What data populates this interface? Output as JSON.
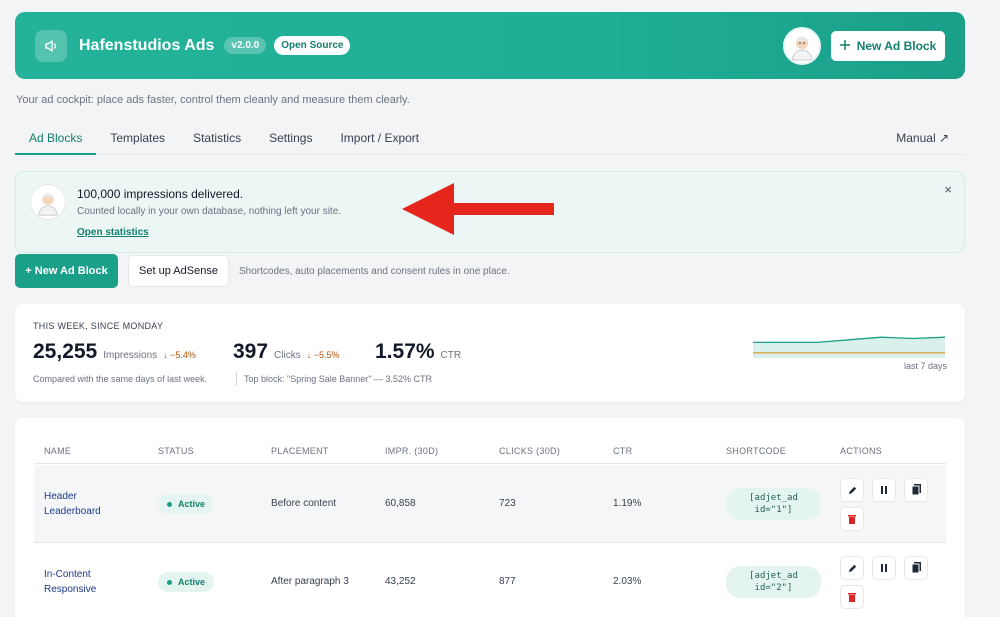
{
  "header": {
    "title": "Hafenstudios Ads",
    "version": "v2.0.0",
    "badge": "Open Source",
    "new_button": "New Ad Block",
    "icon": "megaphone-icon"
  },
  "tagline": "Your ad cockpit: place ads faster, control them cleanly and measure them clearly.",
  "tabs": [
    {
      "label": "Ad Blocks",
      "active": true
    },
    {
      "label": "Templates"
    },
    {
      "label": "Statistics"
    },
    {
      "label": "Settings"
    },
    {
      "label": "Import / Export"
    }
  ],
  "manual_link": "Manual ↗",
  "notice": {
    "title": "100,000 impressions delivered.",
    "text": "Counted locally in your own database, nothing left your site.",
    "link": "Open statistics",
    "close": "×"
  },
  "actions": {
    "new_block": "+ New Ad Block",
    "adsense": "Set up AdSense",
    "hint": "Shortcodes, auto placements and consent rules in one place."
  },
  "stats": {
    "caption": "THIS WEEK, SINCE MONDAY",
    "impressions": {
      "value": "25,255",
      "label": "Impressions",
      "delta": "↓ −5.4%"
    },
    "clicks": {
      "value": "397",
      "label": "Clicks",
      "delta": "↓ −5.5%"
    },
    "ctr": {
      "value": "1.57%",
      "label": "CTR"
    },
    "compare": "Compared with the same days of last week.",
    "top_block": "Top block: \"Spring Sale Banner\" — 3.52% CTR",
    "spark_label": "last 7 days",
    "spark_values": [
      6,
      6,
      6,
      7,
      8,
      7.5,
      8
    ],
    "spark_prev": [
      2,
      2,
      2,
      2,
      2,
      2,
      2
    ]
  },
  "table": {
    "headers": [
      "NAME",
      "STATUS",
      "PLACEMENT",
      "IMPR. (30D)",
      "CLICKS (30D)",
      "CTR",
      "SHORTCODE",
      "ACTIONS"
    ],
    "rows": [
      {
        "name": "Header Leaderboard",
        "status": "Active",
        "placement": "Before content",
        "impressions": "60,858",
        "clicks": "723",
        "ctr": "1.19%",
        "shortcode": "[adjet_ad\nid=\"1\"]"
      },
      {
        "name": "In-Content Responsive",
        "status": "Active",
        "placement": "After paragraph 3",
        "impressions": "43,252",
        "clicks": "877",
        "ctr": "2.03%",
        "shortcode": "[adjet_ad\nid=\"2\"]"
      }
    ]
  },
  "colors": {
    "accent": "#1a9f89",
    "accent_dark": "#137e6d",
    "warning": "#b45309",
    "danger": "#dc2626",
    "arrow": "#e5261d"
  }
}
